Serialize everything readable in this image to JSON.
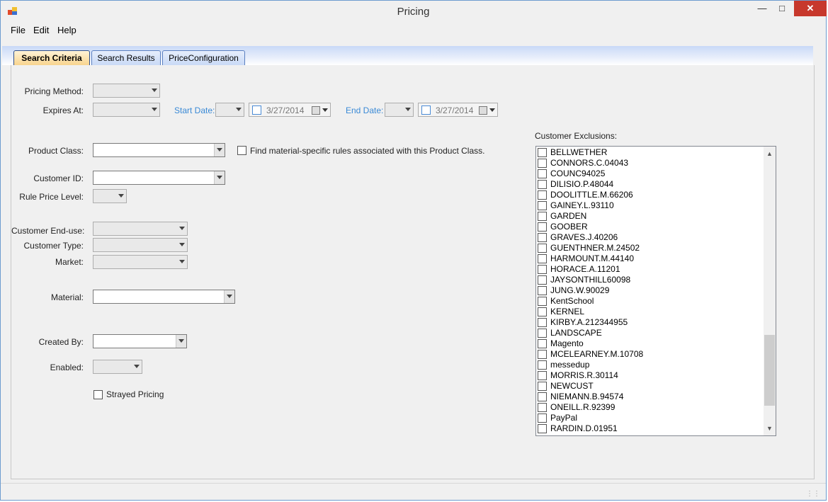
{
  "window": {
    "title": "Pricing"
  },
  "menu": {
    "file": "File",
    "edit": "Edit",
    "help": "Help"
  },
  "tabs": [
    {
      "label": "Search Criteria",
      "active": true
    },
    {
      "label": "Search Results"
    },
    {
      "label": "PriceConfiguration"
    }
  ],
  "form": {
    "pricing_method": "Pricing Method:",
    "expires_at": "Expires At:",
    "start_date": "Start Date:",
    "start_date_value": "3/27/2014",
    "end_date": "End Date:",
    "end_date_value": "3/27/2014",
    "product_class": "Product Class:",
    "find_material": "Find material-specific rules associated with this Product Class.",
    "customer_id": "Customer ID:",
    "rule_price_level": "Rule Price Level:",
    "customer_end_use": "Customer End-use:",
    "customer_type": "Customer Type:",
    "market": "Market:",
    "material": "Material:",
    "created_by": "Created By:",
    "enabled": "Enabled:",
    "strayed_pricing": "Strayed Pricing",
    "customer_exclusions": "Customer Exclusions:"
  },
  "exclusions": [
    "BELLWETHER",
    "CONNORS.C.04043",
    "COUNC94025",
    "DILISIO.P.48044",
    "DOOLITTLE.M.66206",
    "GAINEY.L.93110",
    "GARDEN",
    "GOOBER",
    "GRAVES.J.40206",
    "GUENTHNER.M.24502",
    "HARMOUNT.M.44140",
    "HORACE.A.11201",
    "JAYSONTHILL60098",
    "JUNG.W.90029",
    "KentSchool",
    "KERNEL",
    "KIRBY.A.212344955",
    "LANDSCAPE",
    "Magento",
    "MCELEARNEY.M.10708",
    "messedup",
    "MORRIS.R.30114",
    "NEWCUST",
    "NIEMANN.B.94574",
    "ONEILL.R.92399",
    "PayPal",
    "RARDIN.D.01951"
  ],
  "colors": {
    "accent": "#3a8ad6",
    "close": "#c7382c"
  }
}
